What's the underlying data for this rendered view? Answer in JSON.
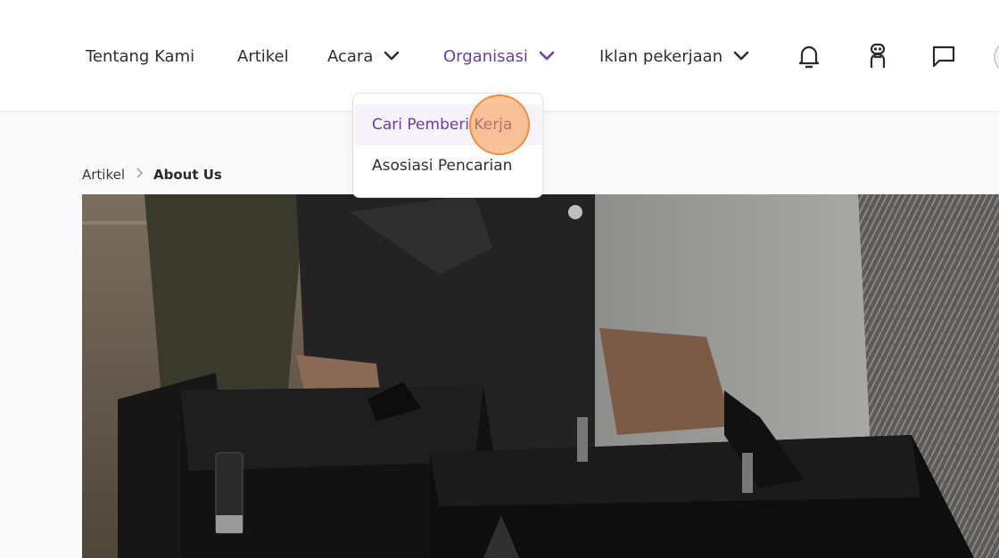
{
  "nav": {
    "items": [
      {
        "label": "Tentang Kami"
      },
      {
        "label": "Artikel"
      },
      {
        "label": "Acara"
      },
      {
        "label": "Organisasi"
      },
      {
        "label": "Iklan pekerjaan"
      }
    ],
    "active": "Organisasi",
    "icons": [
      "bell-icon",
      "robot-icon",
      "chat-icon"
    ]
  },
  "dropdown": {
    "items": [
      {
        "label": "Cari Pemberi Kerja"
      },
      {
        "label": "Asosiasi Pencarian"
      }
    ],
    "highlighted": "Cari Pemberi Kerja"
  },
  "breadcrumb": {
    "parent": "Artikel",
    "current": "About Us"
  },
  "colors": {
    "accent": "#6b3fa0",
    "click_marker": "#f79646"
  }
}
